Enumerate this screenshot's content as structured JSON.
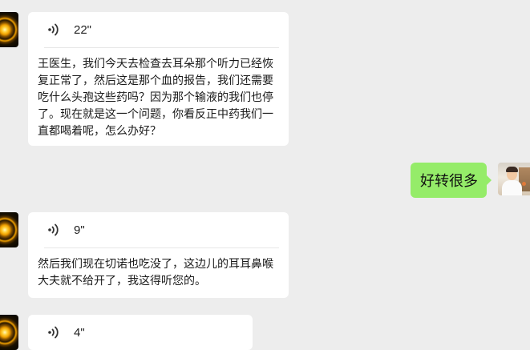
{
  "messages": [
    {
      "sender": "left",
      "type": "voice",
      "duration": "22\"",
      "transcript": "王医生，我们今天去检查去耳朵那个听力已经恢复正常了，然后这是那个血的报告，我们还需要吃什么头孢这些药吗？因为那个输液的我们也停了。现在就是这一个问题，你看反正中药我们一直都喝着呢，怎么办好？"
    },
    {
      "sender": "right",
      "type": "text",
      "text": "好转很多"
    },
    {
      "sender": "left",
      "type": "voice",
      "duration": "9\"",
      "transcript": "然后我们现在切诺也吃没了，这边儿的耳耳鼻喉大夫就不给开了，我这得听您的。"
    },
    {
      "sender": "left",
      "type": "voice",
      "duration": "4\"",
      "transcript": ""
    }
  ],
  "icons": {
    "voice": "voice-wave-icon"
  },
  "colors": {
    "background": "#ededed",
    "received_bubble": "#ffffff",
    "sent_bubble": "#95ec69"
  }
}
